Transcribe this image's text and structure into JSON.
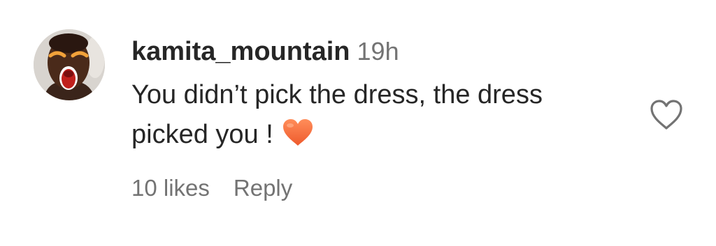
{
  "comment": {
    "username": "kamita_mountain",
    "timestamp": "19h",
    "text_line1": "You didn’t pick the dress, the dress",
    "text_line2": "picked you !",
    "emoji": "orange-heart",
    "likes_label": "10 likes",
    "reply_label": "Reply"
  },
  "icons": {
    "like": "heart-outline-icon",
    "avatar": "user-avatar"
  },
  "colors": {
    "primary_text": "#262626",
    "secondary_text": "#737373",
    "emoji_heart": "#f26a3d",
    "icon_stroke": "#737373"
  }
}
